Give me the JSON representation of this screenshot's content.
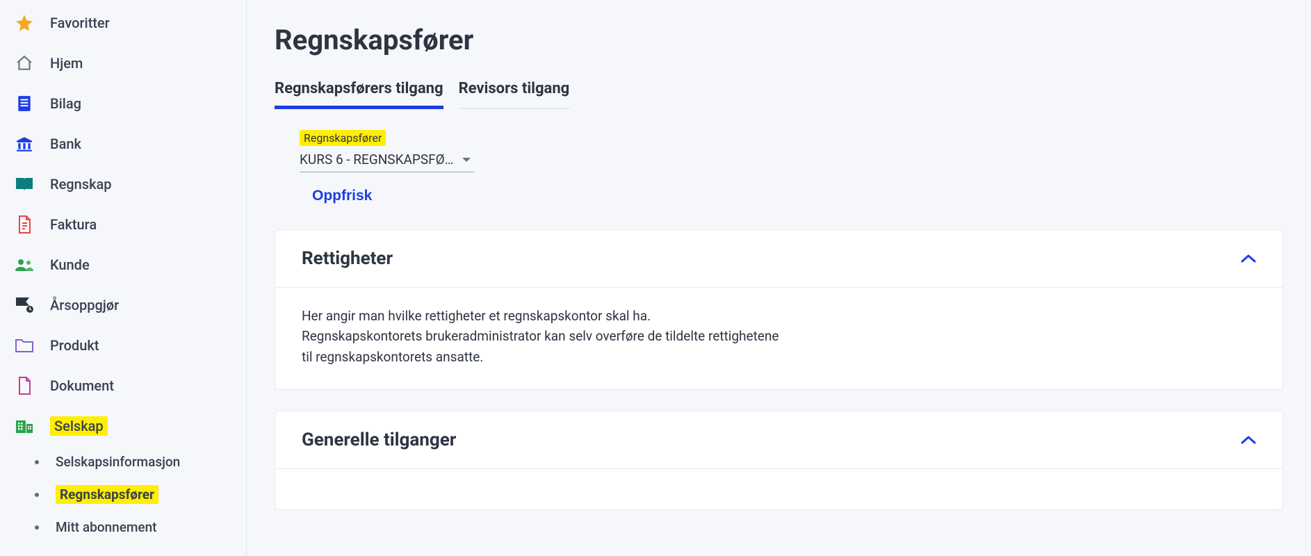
{
  "sidebar": {
    "items": [
      {
        "label": "Favoritter",
        "icon": "star"
      },
      {
        "label": "Hjem",
        "icon": "home"
      },
      {
        "label": "Bilag",
        "icon": "receipt"
      },
      {
        "label": "Bank",
        "icon": "bank"
      },
      {
        "label": "Regnskap",
        "icon": "book"
      },
      {
        "label": "Faktura",
        "icon": "invoice"
      },
      {
        "label": "Kunde",
        "icon": "people"
      },
      {
        "label": "Årsoppgjør",
        "icon": "flag"
      },
      {
        "label": "Produkt",
        "icon": "folder"
      },
      {
        "label": "Dokument",
        "icon": "document"
      },
      {
        "label": "Selskap",
        "icon": "company",
        "highlighted": true
      }
    ],
    "sub_items": [
      {
        "label": "Selskapsinformasjon"
      },
      {
        "label": "Regnskapsfører",
        "highlighted": true,
        "active": true
      },
      {
        "label": "Mitt abonnement"
      }
    ]
  },
  "page": {
    "title": "Regnskapsfører",
    "tabs": [
      {
        "label": "Regnskapsførers tilgang",
        "active": true
      },
      {
        "label": "Revisors tilgang",
        "active": false
      }
    ],
    "select": {
      "label": "Regnskapsfører",
      "value": "KURS 6 - REGNSKAPSFØ…"
    },
    "refresh_label": "Oppfrisk",
    "panels": [
      {
        "title": "Rettigheter",
        "body_line1": "Her angir man hvilke rettigheter et regnskapskontor skal ha.",
        "body_line2": "Regnskapskontorets brukeradministrator kan selv overføre de tildelte rettighetene",
        "body_line3": "til regnskapskontorets ansatte."
      },
      {
        "title": "Generelle tilganger"
      }
    ]
  }
}
